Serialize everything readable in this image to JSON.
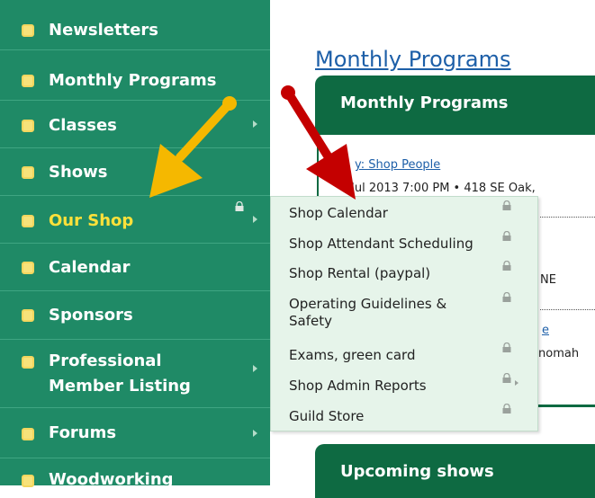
{
  "sidebar": {
    "items": [
      {
        "label": "Newsletters"
      },
      {
        "label": "Monthly Programs"
      },
      {
        "label": "Classes"
      },
      {
        "label": "Shows"
      },
      {
        "label": "Our Shop"
      },
      {
        "label": "Calendar"
      },
      {
        "label": "Sponsors"
      },
      {
        "label": "Professional",
        "label2": "Member Listing"
      },
      {
        "label": "Forums"
      },
      {
        "label": "Woodworking"
      }
    ]
  },
  "main": {
    "title": "Monthly Programs",
    "box_header": "Monthly Programs",
    "event_link_partial": "y: Shop People",
    "event_detail_partial": "Jul 2013 7:00 PM • 418 SE Oak,",
    "snippet_ne": "NE",
    "snippet_e": "e",
    "snippet_nomah": "nomah",
    "upcoming_header": "Upcoming shows"
  },
  "submenu": {
    "items": [
      "Shop Calendar",
      "Shop Attendant Scheduling",
      "Shop Rental (paypal)",
      "Operating Guidelines & Safety",
      "Exams, green card",
      "Shop Admin Reports",
      "Guild Store"
    ]
  },
  "colors": {
    "sidebar_bg": "#1f8a66",
    "active_text": "#ffe13a",
    "submenu_bg": "#e6f4ea",
    "header_bg": "#0e6a42",
    "link": "#1d5fa8",
    "arrow_yellow": "#f5b800",
    "arrow_red": "#c40000"
  }
}
